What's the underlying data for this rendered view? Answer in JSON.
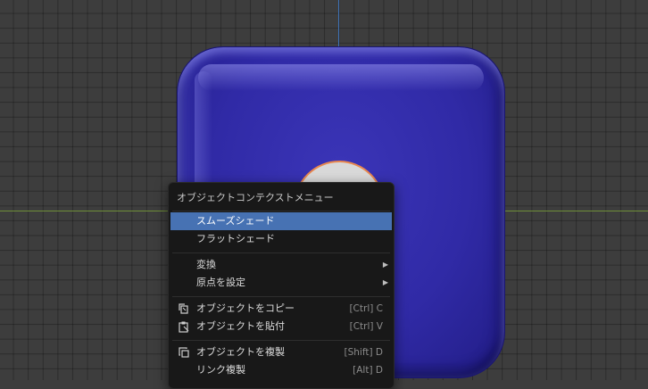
{
  "viewport": {
    "object_color": "#302aa6",
    "selection_outline": "#e9884f"
  },
  "context_menu": {
    "title": "オブジェクトコンテクストメニュー",
    "items": [
      {
        "label": "スムーズシェード",
        "active": true
      },
      {
        "label": "フラットシェード"
      },
      {
        "label": "変換",
        "submenu": true
      },
      {
        "label": "原点を設定",
        "submenu": true
      },
      {
        "label": "オブジェクトをコピー",
        "shortcut": "[Ctrl] C",
        "icon": "copy-icon"
      },
      {
        "label": "オブジェクトを貼付",
        "shortcut": "[Ctrl] V",
        "icon": "paste-icon"
      },
      {
        "label": "オブジェクトを複製",
        "shortcut": "[Shift] D",
        "icon": "duplicate-icon"
      },
      {
        "label": "リンク複製",
        "shortcut": "[Alt] D"
      }
    ],
    "submenu_arrow": "▶",
    "accent": "#4772b3"
  }
}
